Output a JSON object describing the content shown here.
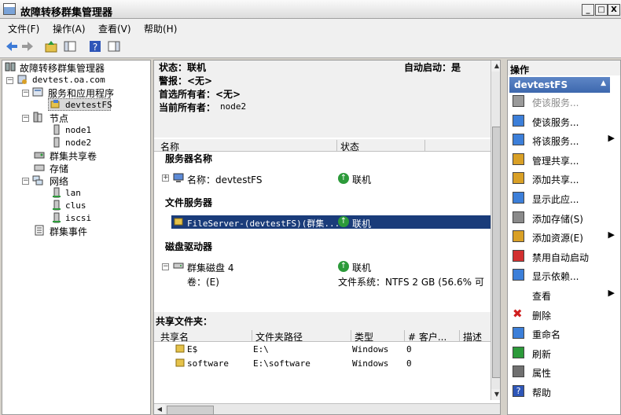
{
  "window": {
    "title": "故障转移群集管理器",
    "min": "_",
    "max": "□",
    "close": "X"
  },
  "menu": [
    "文件(F)",
    "操作(A)",
    "查看(V)",
    "帮助(H)"
  ],
  "tree": {
    "root": "故障转移群集管理器",
    "cluster": "devtest.oa.com",
    "services": "服务和应用程序",
    "service_item": "devtestFS",
    "nodes": "节点",
    "node1": "node1",
    "node2": "node2",
    "shared_volumes": "群集共享卷",
    "storage": "存储",
    "networks": "网络",
    "net1": "lan",
    "net2": "clus",
    "net3": "iscsi",
    "events": "群集事件"
  },
  "summary": {
    "status_label": "状态：联机",
    "alert_label": "警报：<无>",
    "preferred_owner": "首选所有者：<无>",
    "current_owner_label": "当前所有者：",
    "current_owner": "node2",
    "autostart": "自动启动：是"
  },
  "resources": {
    "col_name": "名称",
    "col_status": "状态",
    "groups": [
      {
        "title": "服务器名称",
        "items": [
          {
            "name": "名称：devtestFS",
            "status": "联机"
          }
        ]
      },
      {
        "title": "文件服务器",
        "items": [
          {
            "name": "FileServer-(devtestFS)(群集...",
            "status": "联机"
          }
        ]
      },
      {
        "title": "磁盘驱动器",
        "items": [
          {
            "name": "群集磁盘 4",
            "status": "联机",
            "detail_left": "卷：(E)",
            "detail_right": "文件系统：NTFS    2 GB (56.6% 可"
          }
        ]
      }
    ]
  },
  "shares": {
    "title": "共享文件夹：",
    "columns": [
      "共享名",
      "文件夹路径",
      "类型",
      "# 客户...",
      "描述"
    ],
    "rows": [
      {
        "name": "E$",
        "path": "E:\\",
        "type": "Windows",
        "clients": "0"
      },
      {
        "name": "software",
        "path": "E:\\software",
        "type": "Windows",
        "clients": "0"
      }
    ]
  },
  "actions": {
    "header": "操作",
    "section": "devtestFS",
    "items": [
      {
        "label": "使该服务...",
        "enabled": false,
        "icon": "bring-online-icon"
      },
      {
        "label": "使该服务...",
        "enabled": true,
        "icon": "take-offline-icon"
      },
      {
        "label": "将该服务...",
        "enabled": true,
        "icon": "move-service-icon",
        "submenu": true
      },
      {
        "label": "管理共享...",
        "enabled": true,
        "icon": "manage-shares-icon"
      },
      {
        "label": "添加共享...",
        "enabled": true,
        "icon": "add-share-icon"
      },
      {
        "label": "显示此应...",
        "enabled": true,
        "icon": "show-report-icon"
      },
      {
        "label": "添加存储(S)",
        "enabled": true,
        "icon": "add-storage-icon"
      },
      {
        "label": "添加资源(E)",
        "enabled": true,
        "icon": "add-resource-icon",
        "submenu": true
      },
      {
        "label": "禁用自动启动",
        "enabled": true,
        "icon": "disable-autostart-icon"
      },
      {
        "label": "显示依赖...",
        "enabled": true,
        "icon": "show-dependency-icon"
      },
      {
        "label": "查看",
        "enabled": true,
        "icon": "",
        "submenu": true
      },
      {
        "label": "删除",
        "enabled": true,
        "icon": "delete-icon"
      },
      {
        "label": "重命名",
        "enabled": true,
        "icon": "rename-icon"
      },
      {
        "label": "刷新",
        "enabled": true,
        "icon": "refresh-icon"
      },
      {
        "label": "属性",
        "enabled": true,
        "icon": "properties-icon"
      },
      {
        "label": "帮助",
        "enabled": true,
        "icon": "help-icon"
      }
    ]
  }
}
